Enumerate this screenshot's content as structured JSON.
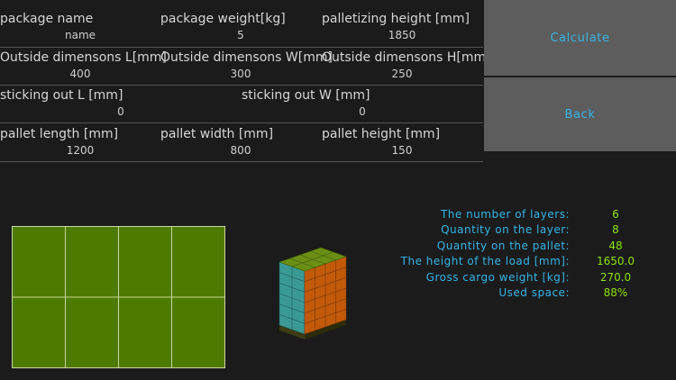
{
  "fields": {
    "package_name": {
      "label": "package name",
      "value": "name"
    },
    "package_weight": {
      "label": "package weight[kg]",
      "value": "5"
    },
    "palletizing_height": {
      "label": "palletizing height [mm]",
      "value": "1850"
    },
    "outside_l": {
      "label": "Outside dimensons L[mm]",
      "value": "400"
    },
    "outside_w": {
      "label": "Outside dimensons W[mm]",
      "value": "300"
    },
    "outside_h": {
      "label": "Outside dimensons H[mm]",
      "value": "250"
    },
    "sticking_l": {
      "label": "sticking out L [mm]",
      "value": "0"
    },
    "sticking_w": {
      "label": "sticking out W [mm]",
      "value": "0"
    },
    "pallet_length": {
      "label": "pallet length [mm]",
      "value": "1200"
    },
    "pallet_width": {
      "label": "pallet width [mm]",
      "value": "800"
    },
    "pallet_height": {
      "label": "pallet height [mm]",
      "value": "150"
    }
  },
  "buttons": {
    "calculate": "Calculate",
    "back": "Back"
  },
  "results": [
    {
      "label": "The number of layers:",
      "value": "6"
    },
    {
      "label": "Quantity on the layer:",
      "value": "8"
    },
    {
      "label": "Quantity on the pallet:",
      "value": "48"
    },
    {
      "label": "The height of the load [mm]:",
      "value": "1650.0"
    },
    {
      "label": "Gross cargo weight [kg]:",
      "value": "270.0"
    },
    {
      "label": "Used space:",
      "value": "88%"
    }
  ],
  "layer_plan": {
    "columns": 4,
    "rows": 2,
    "fill": "#4e7a00",
    "line": "#c8d8a0"
  },
  "colors": {
    "accent": "#33b5e5",
    "value_green": "#8ee000",
    "button_bg": "#5d5d5d",
    "side_teal": "#3a9a93",
    "side_orange": "#c25a0a",
    "top_green": "#6a8f14"
  }
}
